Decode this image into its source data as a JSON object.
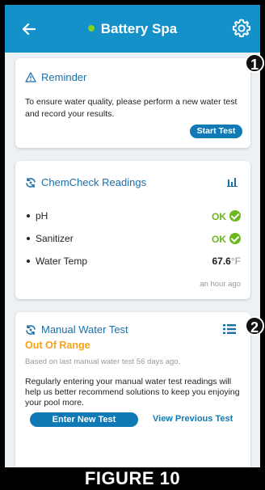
{
  "header": {
    "title": "Battery Spa",
    "status_color": "#7ed321"
  },
  "reminder": {
    "title": "Reminder",
    "icon": "warning-triangle-icon",
    "text": "To ensure water quality, please perform a new water test and record your results.",
    "button": "Start Test"
  },
  "chemcheck": {
    "title": "ChemCheck Readings",
    "icon": "sync-icon",
    "chart_icon": "bar-chart-icon",
    "readings": [
      {
        "label": "pH",
        "value": "OK"
      },
      {
        "label": "Sanitizer",
        "value": "OK"
      },
      {
        "label": "Water Temp",
        "value": "67.6",
        "unit": "°F"
      }
    ],
    "updated": "an hour ago"
  },
  "manual": {
    "title": "Manual Water Test",
    "icon": "sync-icon",
    "list_icon": "list-icon",
    "status": "Out Of Range",
    "status_color": "#f5a21a",
    "based_on": "Based on last manual water test 56 days ago.",
    "message": "Regularly entering your manual water test readings will help us better recommend solutions to keep you enjoying your pool more.",
    "enter_button": "Enter New Test",
    "view_link": "View Previous Test"
  },
  "callouts": [
    "1",
    "2"
  ],
  "caption": "FIGURE 10",
  "colors": {
    "header": "#1591c9",
    "accent": "#0f7ab5",
    "ok": "#6ab81e"
  }
}
